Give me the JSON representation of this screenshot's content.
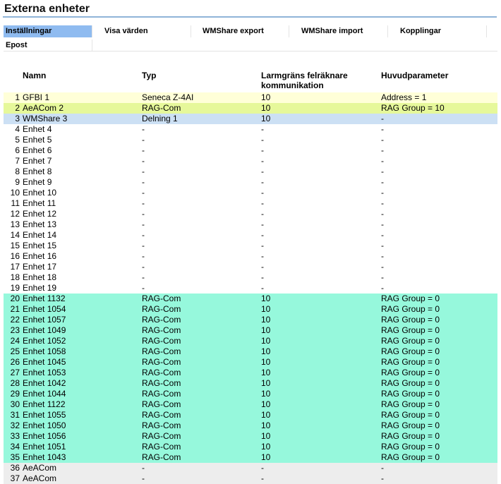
{
  "page": {
    "title": "Externa enheter"
  },
  "tabs": [
    {
      "label": "Inställningar",
      "active": true
    },
    {
      "label": "Visa värden",
      "active": false
    },
    {
      "label": "WMShare export",
      "active": false
    },
    {
      "label": "WMShare import",
      "active": false
    },
    {
      "label": "Kopplingar",
      "active": false
    },
    {
      "label": "Epost",
      "active": false
    }
  ],
  "columns": {
    "name": "Namn",
    "type": "Typ",
    "alarm_line1": "Larmgräns felräknare",
    "alarm_line2": "kommunikation",
    "param": "Huvudparameter"
  },
  "colors": {
    "yellow": "#ffffd8",
    "lime": "#e6f89a",
    "blue": "#cce0f4",
    "white": "#ffffff",
    "teal": "#96f8dc",
    "gray": "#ededed"
  },
  "rows": [
    {
      "num": "1",
      "name": "GFBI 1",
      "type": "Seneca Z-4AI",
      "alarm": "10",
      "param": "Address = 1",
      "color": "yellow"
    },
    {
      "num": "2",
      "name": "AeACom 2",
      "type": "RAG-Com",
      "alarm": "10",
      "param": "RAG Group = 10",
      "color": "lime"
    },
    {
      "num": "3",
      "name": "WMShare 3",
      "type": "Delning 1",
      "alarm": "10",
      "param": "-",
      "color": "blue"
    },
    {
      "num": "4",
      "name": "Enhet 4",
      "type": "-",
      "alarm": "-",
      "param": "-",
      "color": "white"
    },
    {
      "num": "5",
      "name": "Enhet 5",
      "type": "-",
      "alarm": "-",
      "param": "-",
      "color": "white"
    },
    {
      "num": "6",
      "name": "Enhet 6",
      "type": "-",
      "alarm": "-",
      "param": "-",
      "color": "white"
    },
    {
      "num": "7",
      "name": "Enhet 7",
      "type": "-",
      "alarm": "-",
      "param": "-",
      "color": "white"
    },
    {
      "num": "8",
      "name": "Enhet 8",
      "type": "-",
      "alarm": "-",
      "param": "-",
      "color": "white"
    },
    {
      "num": "9",
      "name": "Enhet 9",
      "type": "-",
      "alarm": "-",
      "param": "-",
      "color": "white"
    },
    {
      "num": "10",
      "name": "Enhet 10",
      "type": "-",
      "alarm": "-",
      "param": "-",
      "color": "white"
    },
    {
      "num": "11",
      "name": "Enhet 11",
      "type": "-",
      "alarm": "-",
      "param": "-",
      "color": "white"
    },
    {
      "num": "12",
      "name": "Enhet 12",
      "type": "-",
      "alarm": "-",
      "param": "-",
      "color": "white"
    },
    {
      "num": "13",
      "name": "Enhet 13",
      "type": "-",
      "alarm": "-",
      "param": "-",
      "color": "white"
    },
    {
      "num": "14",
      "name": "Enhet 14",
      "type": "-",
      "alarm": "-",
      "param": "-",
      "color": "white"
    },
    {
      "num": "15",
      "name": "Enhet 15",
      "type": "-",
      "alarm": "-",
      "param": "-",
      "color": "white"
    },
    {
      "num": "16",
      "name": "Enhet 16",
      "type": "-",
      "alarm": "-",
      "param": "-",
      "color": "white"
    },
    {
      "num": "17",
      "name": "Enhet 17",
      "type": "-",
      "alarm": "-",
      "param": "-",
      "color": "white"
    },
    {
      "num": "18",
      "name": "Enhet 18",
      "type": "-",
      "alarm": "-",
      "param": "-",
      "color": "white"
    },
    {
      "num": "19",
      "name": "Enhet 19",
      "type": "-",
      "alarm": "-",
      "param": "-",
      "color": "white"
    },
    {
      "num": "20",
      "name": "Enhet 1132",
      "type": "RAG-Com",
      "alarm": "10",
      "param": "RAG Group = 0",
      "color": "teal"
    },
    {
      "num": "21",
      "name": "Enhet 1054",
      "type": "RAG-Com",
      "alarm": "10",
      "param": "RAG Group = 0",
      "color": "teal"
    },
    {
      "num": "22",
      "name": "Enhet 1057",
      "type": "RAG-Com",
      "alarm": "10",
      "param": "RAG Group = 0",
      "color": "teal"
    },
    {
      "num": "23",
      "name": "Enhet 1049",
      "type": "RAG-Com",
      "alarm": "10",
      "param": "RAG Group = 0",
      "color": "teal"
    },
    {
      "num": "24",
      "name": "Enhet 1052",
      "type": "RAG-Com",
      "alarm": "10",
      "param": "RAG Group = 0",
      "color": "teal"
    },
    {
      "num": "25",
      "name": "Enhet 1058",
      "type": "RAG-Com",
      "alarm": "10",
      "param": "RAG Group = 0",
      "color": "teal"
    },
    {
      "num": "26",
      "name": "Enhet 1045",
      "type": "RAG-Com",
      "alarm": "10",
      "param": "RAG Group = 0",
      "color": "teal"
    },
    {
      "num": "27",
      "name": "Enhet 1053",
      "type": "RAG-Com",
      "alarm": "10",
      "param": "RAG Group = 0",
      "color": "teal"
    },
    {
      "num": "28",
      "name": "Enhet 1042",
      "type": "RAG-Com",
      "alarm": "10",
      "param": "RAG Group = 0",
      "color": "teal"
    },
    {
      "num": "29",
      "name": "Enhet 1044",
      "type": "RAG-Com",
      "alarm": "10",
      "param": "RAG Group = 0",
      "color": "teal"
    },
    {
      "num": "30",
      "name": "Enhet 1122",
      "type": "RAG-Com",
      "alarm": "10",
      "param": "RAG Group = 0",
      "color": "teal"
    },
    {
      "num": "31",
      "name": "Enhet 1055",
      "type": "RAG-Com",
      "alarm": "10",
      "param": "RAG Group = 0",
      "color": "teal"
    },
    {
      "num": "32",
      "name": "Enhet 1050",
      "type": "RAG-Com",
      "alarm": "10",
      "param": "RAG Group = 0",
      "color": "teal"
    },
    {
      "num": "33",
      "name": "Enhet 1056",
      "type": "RAG-Com",
      "alarm": "10",
      "param": "RAG Group = 0",
      "color": "teal"
    },
    {
      "num": "34",
      "name": "Enhet 1051",
      "type": "RAG-Com",
      "alarm": "10",
      "param": "RAG Group = 0",
      "color": "teal"
    },
    {
      "num": "35",
      "name": "Enhet 1043",
      "type": "RAG-Com",
      "alarm": "10",
      "param": "RAG Group = 0",
      "color": "teal"
    },
    {
      "num": "36",
      "name": "AeACom",
      "type": "-",
      "alarm": "-",
      "param": "-",
      "color": "gray"
    },
    {
      "num": "37",
      "name": "AeACom",
      "type": "-",
      "alarm": "-",
      "param": "-",
      "color": "gray"
    }
  ]
}
